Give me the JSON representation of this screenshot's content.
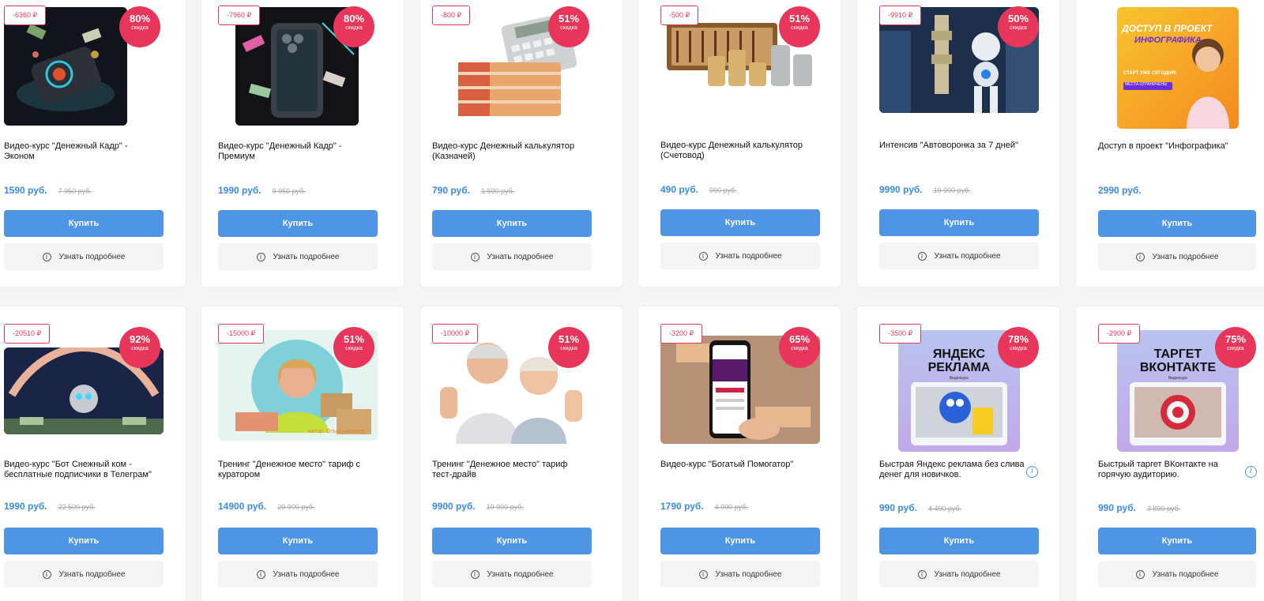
{
  "buy_label": "Купить",
  "more_label": "Узнать подробнее",
  "badge_label": "скидка",
  "accent": "#4f95e6",
  "badge_color": "#e8365a",
  "price_color": "#3a8ae6",
  "products": [
    {
      "title": "Видео-курс \"Денежный Кадр\" - Эконом",
      "price": "1590 руб.",
      "old_price": "7 950 руб.",
      "discount_tag": "-6360 ₽",
      "pct": "80%",
      "thumb": "money-phone"
    },
    {
      "title": "Видео-курс \"Денежный Кадр\" - Премиум",
      "price": "1990 руб.",
      "old_price": "9 950 руб.",
      "discount_tag": "-7960 ₽",
      "pct": "80%",
      "thumb": "money-phone"
    },
    {
      "title": "Видео-курс Денежный калькулятор (Казначей)",
      "price": "790 руб.",
      "old_price": "1 590 руб.",
      "discount_tag": "-800 ₽",
      "pct": "51%",
      "thumb": "calculator-money"
    },
    {
      "title": "Видео-курс Денежный калькулятор (Счетовод)",
      "price": "490 руб.",
      "old_price": "990 руб.",
      "discount_tag": "-500 ₽",
      "pct": "51%",
      "thumb": "abacus-coins"
    },
    {
      "title": "Интенсив \"Автоворонка за 7 дней\"",
      "price": "9990 руб.",
      "old_price": "19 900 руб.",
      "discount_tag": "-9910 ₽",
      "pct": "50%",
      "thumb": "robot-city"
    },
    {
      "title": "Доступ в проект \"Инфографика\"",
      "price": "2990 руб.",
      "old_price": "",
      "discount_tag": "",
      "pct": "",
      "thumb": "infographic-promo",
      "promo_title": "ДОСТУП В ПРОЕКТ",
      "promo_subtitle": "ИНФОГРАФИКА",
      "promo_start": "СТАРТ УЖЕ СЕГОДНЯ!",
      "promo_limited": "МЕСТА ОГРАНИЧЕНЫ"
    },
    {
      "title": "Видео-курс \"Бот Снежный ком - бесплатные подписчики в Телеграм\"",
      "price": "1990 руб.",
      "old_price": "22 500 руб.",
      "discount_tag": "-20510 ₽",
      "pct": "92%",
      "thumb": "robot-hands"
    },
    {
      "title": "Тренинг \"Денежное место\" тариф с куратором",
      "price": "14900 руб.",
      "old_price": "29 900 руб.",
      "discount_tag": "-15000 ₽",
      "pct": "51%",
      "thumb": "woman-boxes",
      "author": "Автор: Ольга Аринина"
    },
    {
      "title": "Тренинг \"Денежное место\" тариф тест-драйв",
      "price": "9900 руб.",
      "old_price": "19 900 руб.",
      "discount_tag": "-10000 ₽",
      "pct": "51%",
      "thumb": "seniors-thumbs"
    },
    {
      "title": "Видео-курс \"Богатый Помогатор\"",
      "price": "1790 руб.",
      "old_price": "4 990 руб.",
      "discount_tag": "-3200 ₽",
      "pct": "65%",
      "thumb": "phone-money"
    },
    {
      "title": "Быстрая Яндекс реклама без слива денег для новичков.",
      "price": "990 руб.",
      "old_price": "4 490 руб.",
      "discount_tag": "-3500 ₽",
      "pct": "78%",
      "thumb": "yandex-ads",
      "promo_title": "ЯНДЕКС РЕКЛАМА",
      "promo_small": "Видеокурс",
      "has_info": true
    },
    {
      "title": "Быстрый таргет ВКонтакте на горячую аудиторию.",
      "price": "990 руб.",
      "old_price": "3 890 руб.",
      "discount_tag": "-2900 ₽",
      "pct": "75%",
      "thumb": "vk-target",
      "promo_title": "ТАРГЕТ ВКОНТАКТЕ",
      "promo_small": "Видеокурс",
      "has_info": true
    }
  ]
}
